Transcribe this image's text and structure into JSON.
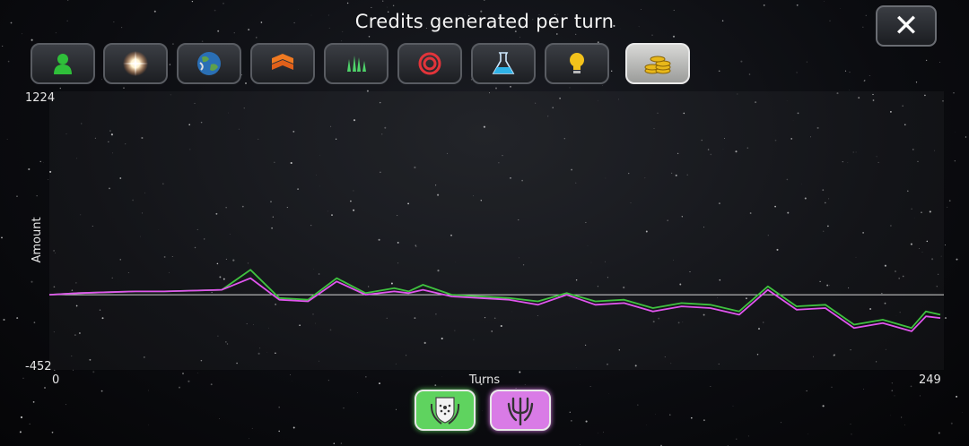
{
  "header": {
    "title": "Credits generated per turn",
    "close_label": "✕"
  },
  "tabs": [
    {
      "icon": "population-icon",
      "active": false
    },
    {
      "icon": "star-icon",
      "active": false
    },
    {
      "icon": "planet-icon",
      "active": false
    },
    {
      "icon": "industry-icon",
      "active": false
    },
    {
      "icon": "fleet-icon",
      "active": false
    },
    {
      "icon": "target-icon",
      "active": false
    },
    {
      "icon": "science-flask-icon",
      "active": false
    },
    {
      "icon": "lightbulb-icon",
      "active": false
    },
    {
      "icon": "credits-coins-icon",
      "active": true
    }
  ],
  "legend": [
    {
      "icon": "laurel-faction-emblem-icon",
      "color": "#5fd35f"
    },
    {
      "icon": "trident-faction-emblem-icon",
      "color": "#d97be6"
    }
  ],
  "chart_data": {
    "type": "line",
    "xlabel": "Turns",
    "ylabel": "Amount",
    "xlim": [
      0,
      249
    ],
    "ylim": [
      -452,
      1224
    ],
    "x_tick_labels": [
      "0",
      "249"
    ],
    "y_tick_labels": [
      "1224",
      "-452"
    ],
    "zero_line": true,
    "grid": false,
    "series": [
      {
        "color": "#3fc23f",
        "x": [
          0,
          8,
          16,
          24,
          32,
          40,
          48,
          56,
          64,
          72,
          80,
          88,
          96,
          100,
          104,
          112,
          120,
          128,
          136,
          144,
          152,
          160,
          168,
          176,
          184,
          192,
          200,
          208,
          216,
          224,
          232,
          240,
          244,
          248
        ],
        "y": [
          0,
          10,
          15,
          20,
          20,
          25,
          30,
          150,
          -20,
          -30,
          100,
          10,
          40,
          20,
          60,
          0,
          -10,
          -20,
          -40,
          10,
          -40,
          -30,
          -80,
          -50,
          -60,
          -100,
          50,
          -70,
          -60,
          -180,
          -150,
          -200,
          -100,
          -120
        ]
      },
      {
        "color": "#e055ee",
        "x": [
          0,
          8,
          16,
          24,
          32,
          40,
          48,
          56,
          64,
          72,
          80,
          88,
          96,
          100,
          104,
          112,
          120,
          128,
          136,
          144,
          152,
          160,
          168,
          176,
          184,
          192,
          200,
          208,
          216,
          224,
          232,
          240,
          244,
          248
        ],
        "y": [
          0,
          10,
          15,
          20,
          20,
          25,
          30,
          100,
          -30,
          -40,
          80,
          0,
          20,
          10,
          30,
          -10,
          -20,
          -30,
          -60,
          0,
          -60,
          -50,
          -100,
          -70,
          -80,
          -120,
          30,
          -90,
          -80,
          -200,
          -170,
          -220,
          -130,
          -140
        ]
      }
    ]
  }
}
